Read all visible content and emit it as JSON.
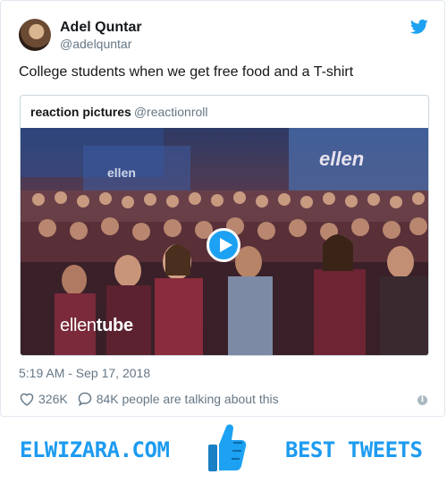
{
  "tweet": {
    "author_name": "Adel Quntar",
    "author_handle": "@adelquntar",
    "text": "College students when we get free food and a T-shirt",
    "timestamp": "5:19 AM - Sep 17, 2018",
    "likes": "326K",
    "talking": "84K people are talking about this"
  },
  "quote": {
    "name": "reaction pictures",
    "handle": "@reactionroll",
    "video_watermark_light": "ellen",
    "video_watermark_bold": "tube",
    "stage_sign": "ellen",
    "stage_sign_small": "ellen"
  },
  "banner": {
    "left_text": "ELWIZARA.COM",
    "right_text": "BEST TWEETS"
  },
  "colors": {
    "twitter_blue": "#1da1f2",
    "banner_blue": "#1d9bf0",
    "muted": "#657786"
  },
  "icons": [
    "twitter-bird-icon",
    "play-icon",
    "heart-icon",
    "comment-bubble-icon",
    "info-icon",
    "thumbs-up-icon"
  ]
}
